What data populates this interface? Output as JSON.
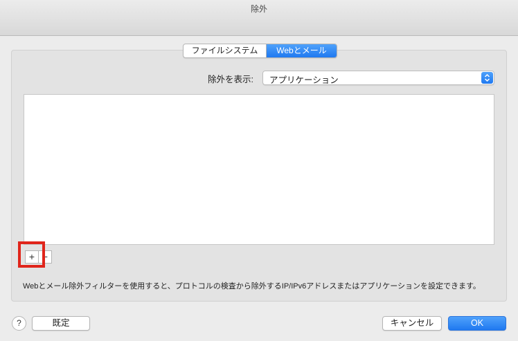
{
  "window": {
    "title": "除外"
  },
  "tabs": [
    {
      "label": "ファイルシステム",
      "selected": false
    },
    {
      "label": "Webとメール",
      "selected": true
    }
  ],
  "filter": {
    "label": "除外を表示:",
    "selected_value": "アプリケーション"
  },
  "list": {
    "items": []
  },
  "list_controls": {
    "add_symbol": "+",
    "remove_symbol": "−"
  },
  "description": "Webとメール除外フィルターを使用すると、プロトコルの検査から除外するIP/IPv6アドレスまたはアプリケーションを設定できます。",
  "footer": {
    "help_label": "?",
    "default_label": "既定",
    "cancel_label": "キャンセル",
    "ok_label": "OK"
  },
  "colors": {
    "accent": "#1f79f0",
    "highlight": "#e0251b"
  },
  "icons": {
    "popup": "updown-chevron-icon"
  }
}
